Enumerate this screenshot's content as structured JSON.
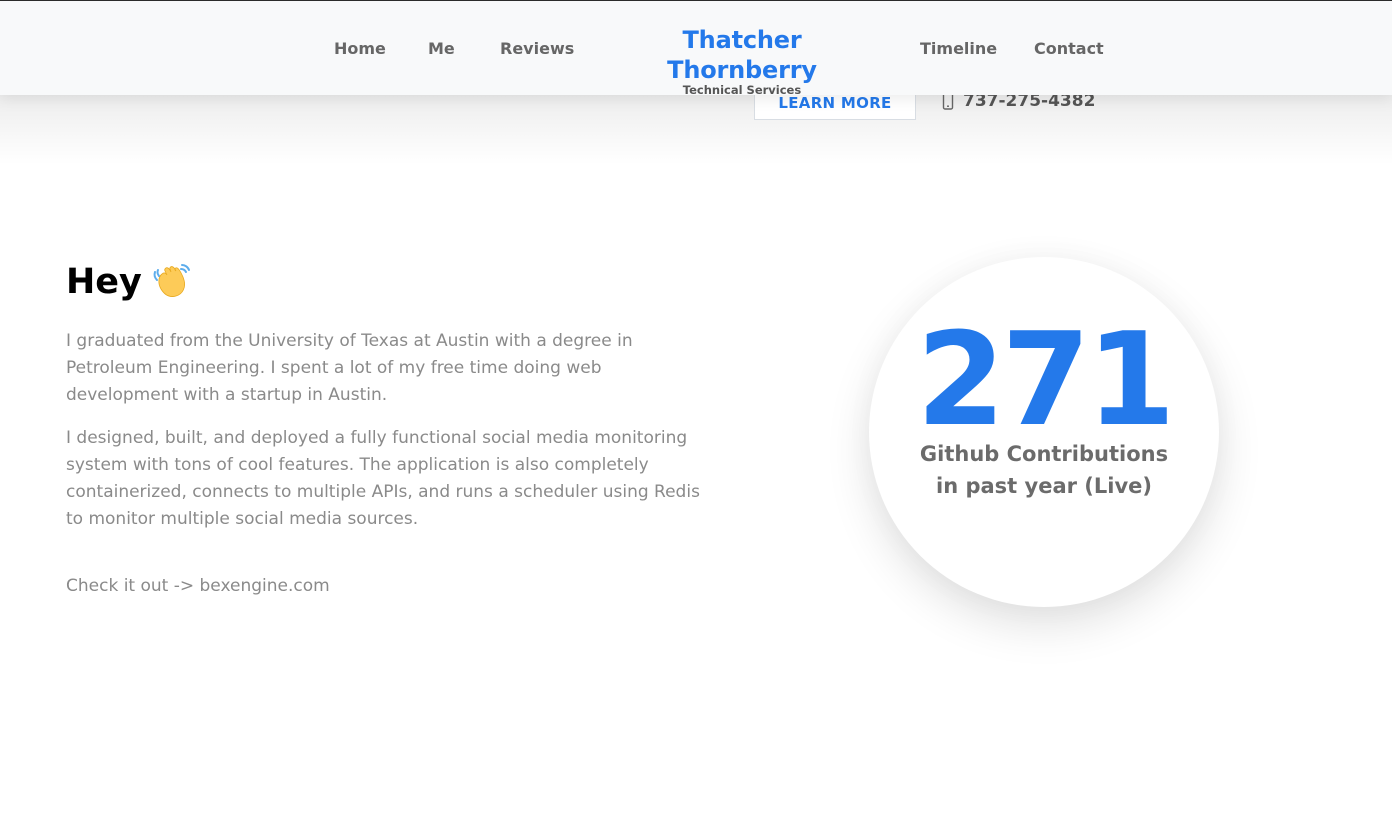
{
  "header": {
    "nav": [
      "Home",
      "Me",
      "Reviews",
      "Timeline",
      "Contact"
    ],
    "brand_name": "Thatcher Thornberry",
    "brand_sub": "Technical Services"
  },
  "cta": {
    "learn_more": "LEARN MORE",
    "phone": "737-275-4382",
    "phone_icon": "phone-icon"
  },
  "about": {
    "heading": "Hey",
    "heading_icon": "waving-hand-icon",
    "paragraph_1": "I graduated from the University of Texas at Austin with a degree in Petroleum Engineering. I spent a lot of my free time doing web development with a startup in Austin.",
    "paragraph_2": "I designed, built, and deployed a fully functional social media monitoring system with tons of cool features. The application is also completely containerized, connects to multiple APIs, and runs a scheduler using Redis to monitor multiple social media sources.",
    "check_it_out": "Check it out -> bexengine.com"
  },
  "stats": {
    "contributions": "271",
    "label_line_1": "Github Contributions",
    "label_line_2": "in past year (Live)"
  },
  "colors": {
    "accent": "#2479ea",
    "body_text": "#8a8a8a",
    "nav_text": "#666666"
  }
}
